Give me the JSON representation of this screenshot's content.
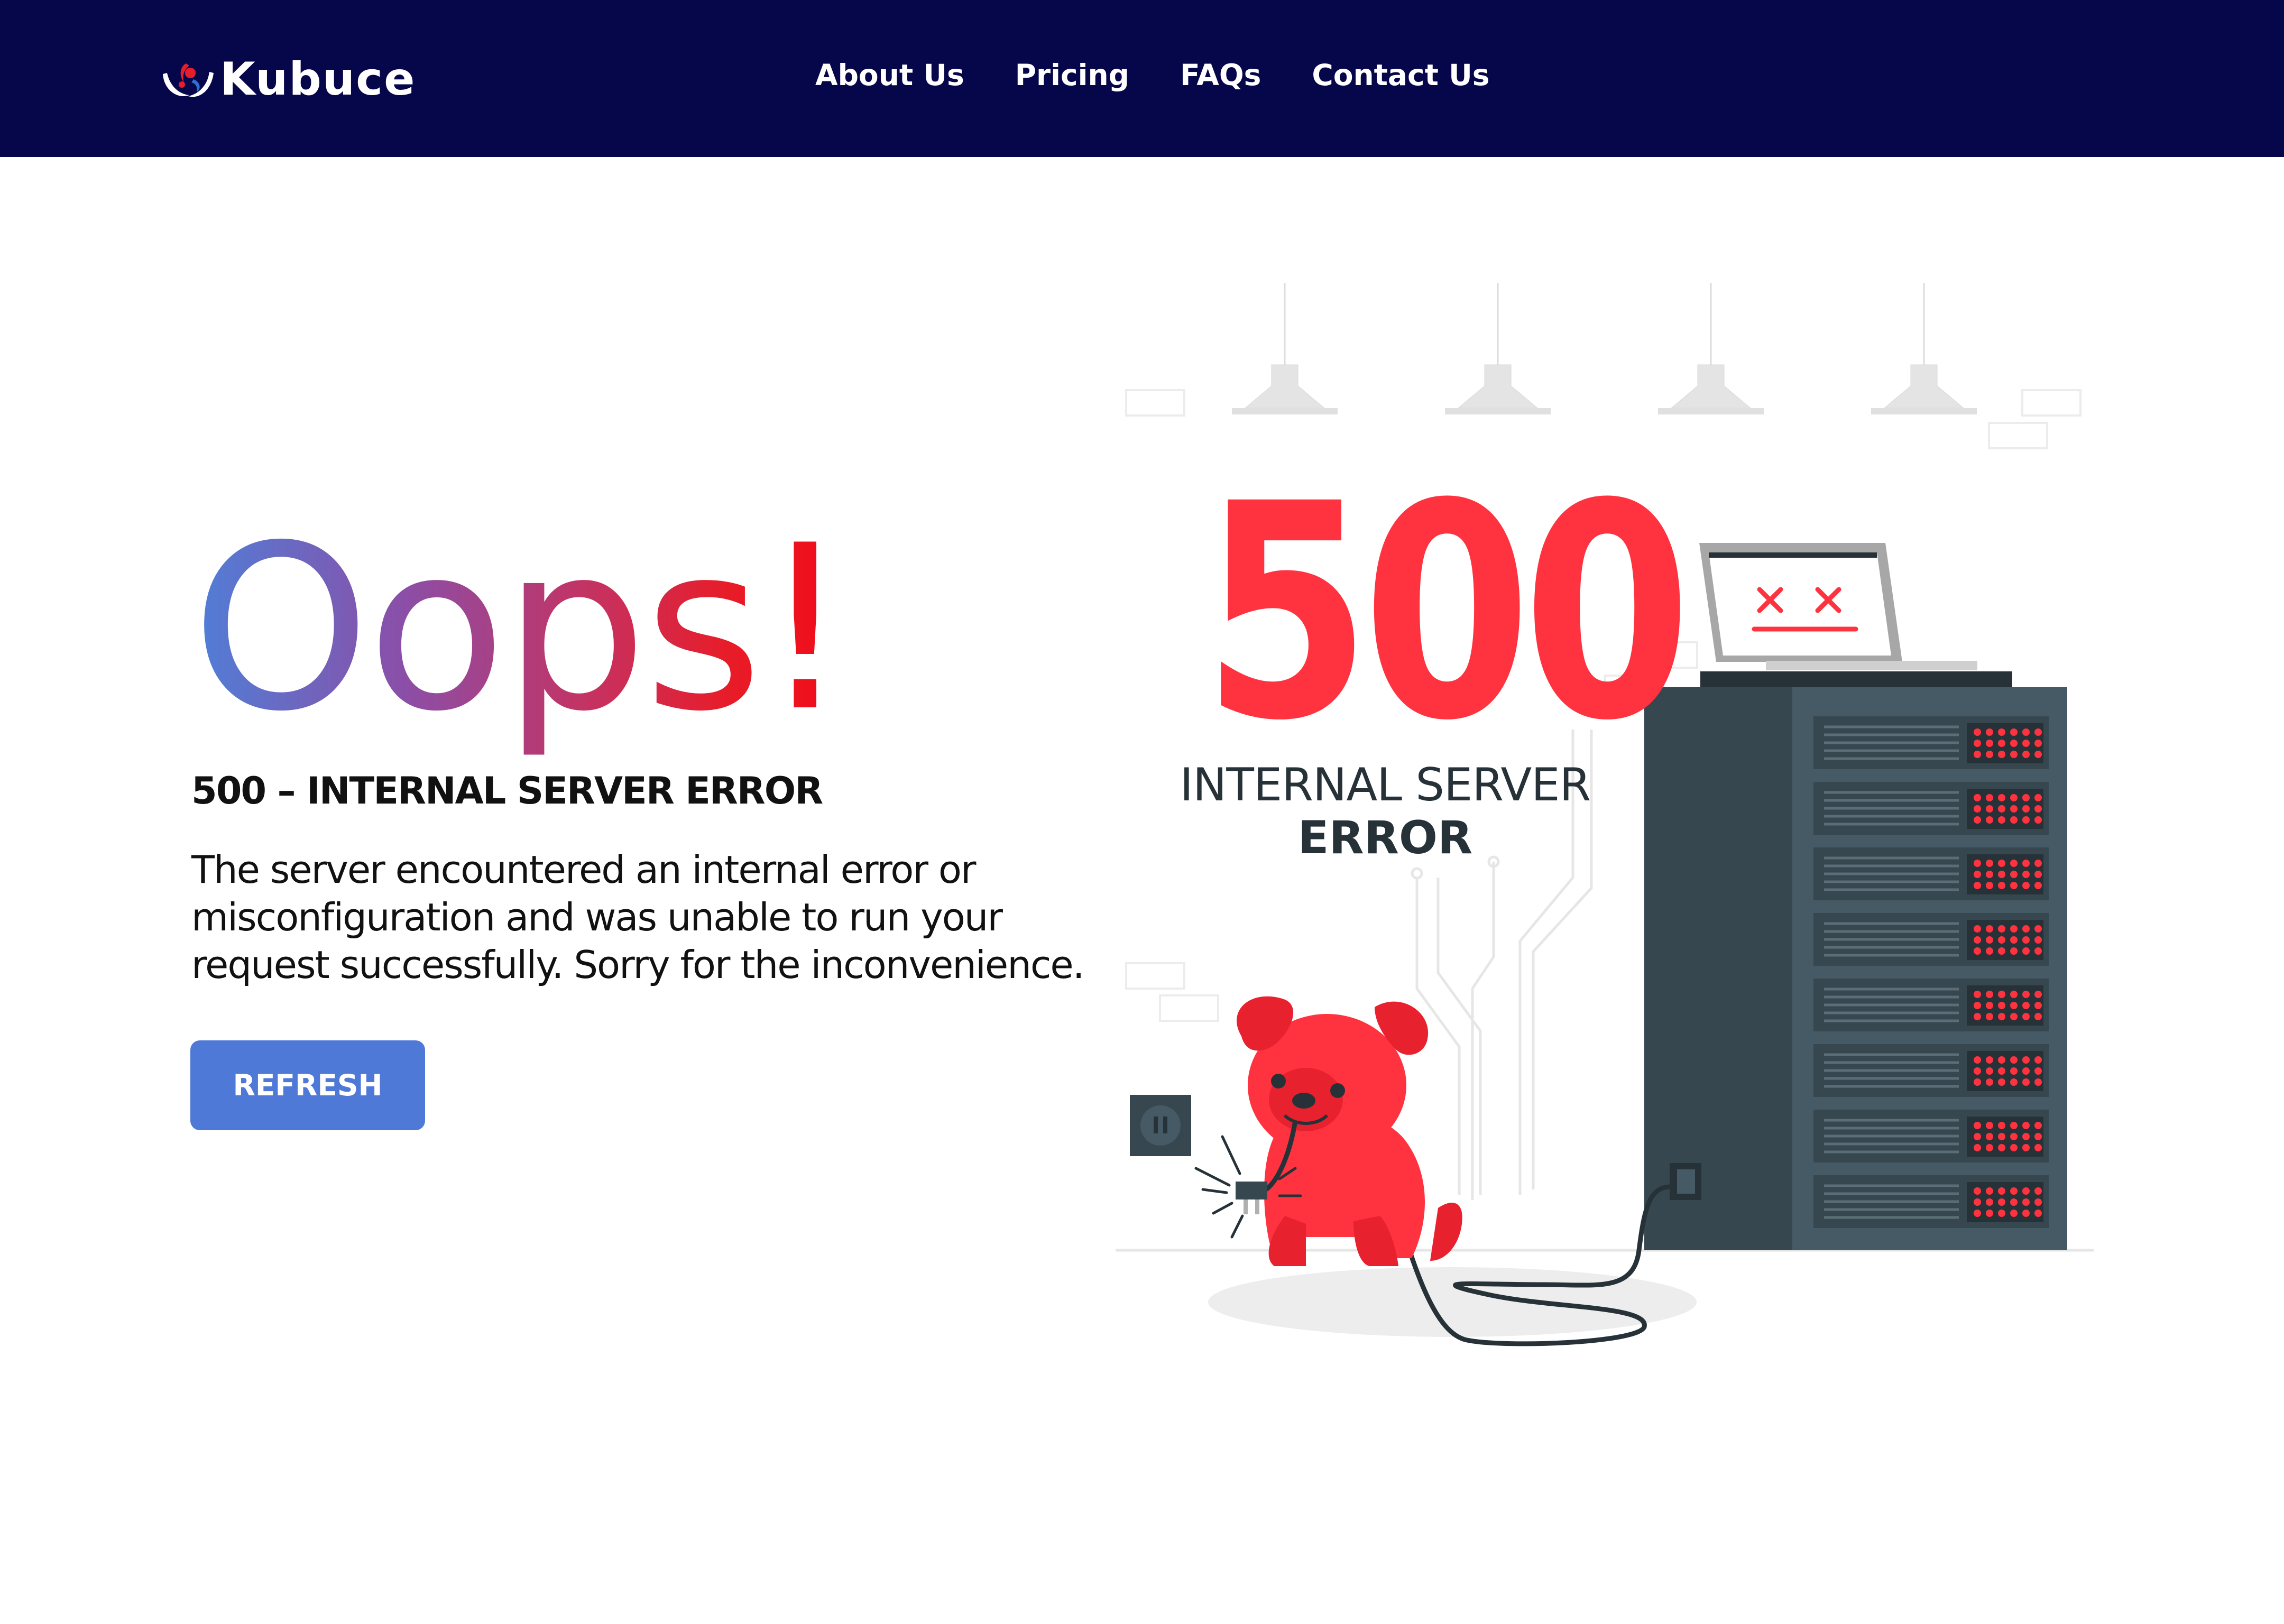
{
  "brand": {
    "name": "Kubuce"
  },
  "nav": {
    "links": [
      {
        "label": "About Us"
      },
      {
        "label": "Pricing"
      },
      {
        "label": "FAQs"
      },
      {
        "label": "Contact Us"
      }
    ]
  },
  "main": {
    "headline": "Oops!",
    "error_title": "500 –  INTERNAL SERVER ERROR",
    "description": "The server encountered an internal error or misconfiguration and was unable to run your request successfully. Sorry for the inconvenience.",
    "refresh_label": "REFRESH"
  },
  "illustration": {
    "code": "500",
    "caption_line1": "INTERNAL SERVER",
    "caption_line2": "ERROR"
  },
  "colors": {
    "nav_bg": "#06064a",
    "accent_red": "#ff3340",
    "button_blue": "#4f79d6",
    "server_dark": "#37474f"
  }
}
